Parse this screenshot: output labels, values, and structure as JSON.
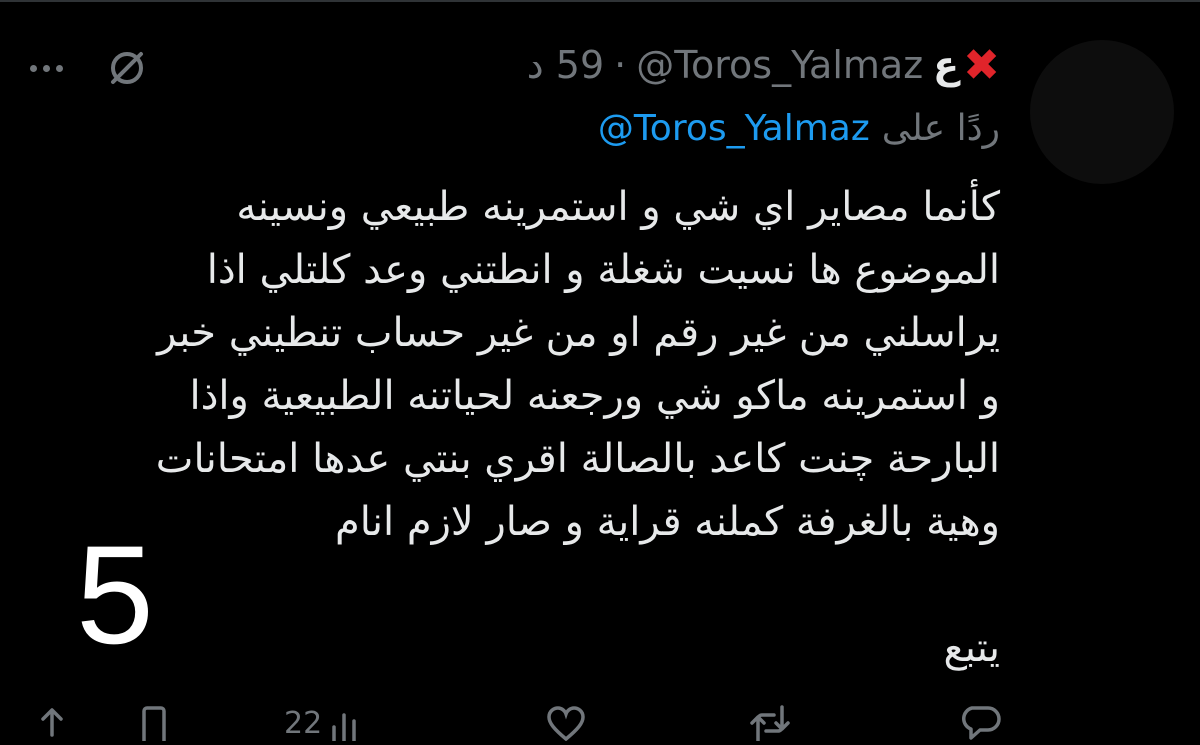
{
  "tweet": {
    "display_name": "ع",
    "handle": "@Toros_Yalmaz",
    "separator": "·",
    "time": "59 د",
    "reply_prefix": "ردًا على",
    "reply_to": "@Toros_Yalmaz",
    "lines": [
      "كأنما مصاير اي شي و استمرينه طبيعي ونسينه",
      "الموضوع ها نسيت شغلة و انطتني وعد كلتلي اذا",
      "يراسلني من غير رقم او من غير حساب تنطيني خبر",
      "و استمرينه ماكو شي ورجعنه لحياتنه الطبيعية واذا",
      "البارحة چنت كاعد بالصالة اقري بنتي عدها امتحانات",
      "وهية بالغرفة كملنه قراية و صار لازم انام"
    ],
    "continue_label": "يتبع",
    "overlay_number": "5"
  },
  "actions": {
    "views_count": "22"
  },
  "icons": {
    "flag": "red-x-icon",
    "grok": "slashed-circle-icon",
    "more": "more-dots-icon"
  },
  "colors": {
    "background": "#000000",
    "text": "#e7e9ea",
    "muted": "#71767b",
    "link": "#1d9bf0",
    "x_mark": "#e0242a"
  }
}
